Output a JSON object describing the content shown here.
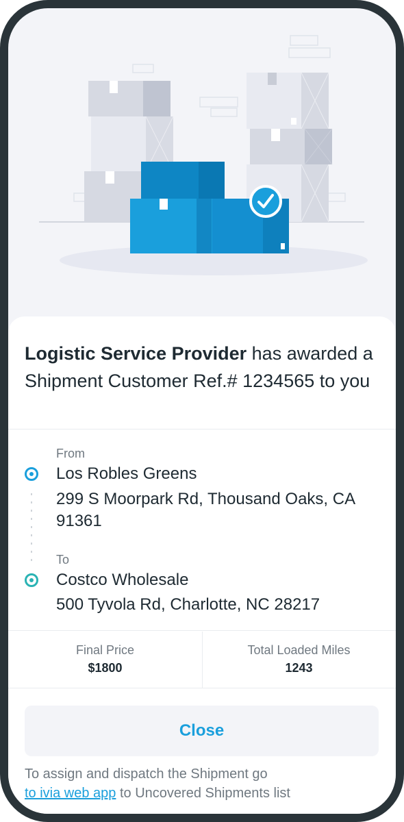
{
  "award": {
    "provider": "Logistic Service Provider",
    "message": "has awarded a Shipment Customer Ref.# 1234565 to you"
  },
  "route": {
    "from": {
      "label": "From",
      "name": "Los Robles Greens",
      "address": "299 S Moorpark Rd, Thousand Oaks, CA 91361"
    },
    "to": {
      "label": "To",
      "name": "Costco Wholesale",
      "address": "500 Tyvola Rd, Charlotte, NC 28217"
    }
  },
  "stats": {
    "final_price_label": "Final Price",
    "final_price_value": "$1800",
    "miles_label": "Total Loaded Miles",
    "miles_value": "1243"
  },
  "close_label": "Close",
  "footer": {
    "before": "To assign and dispatch the Shipment go",
    "link": "to ivia web app",
    "after": "to Uncovered Shipments list"
  },
  "colors": {
    "accent": "#1a9fdc",
    "to_marker": "#2ab3b4",
    "frame": "#2a3439"
  },
  "icons": [
    "boxes-illustration",
    "check-circle-icon"
  ]
}
